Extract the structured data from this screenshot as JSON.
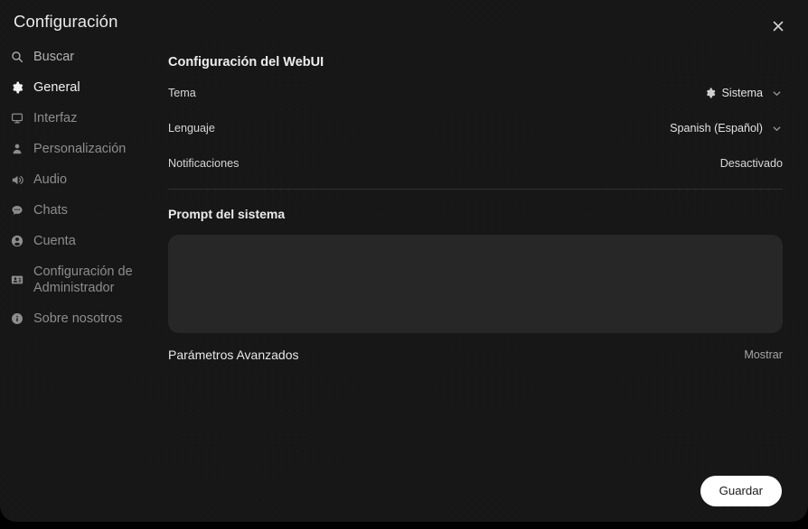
{
  "window": {
    "title": "Configuración",
    "close_icon": "close-icon"
  },
  "sidebar": {
    "items": [
      {
        "id": "buscar",
        "label": "Buscar",
        "icon": "search-icon",
        "active": false,
        "muted": false
      },
      {
        "id": "general",
        "label": "General",
        "icon": "gear-icon",
        "active": true,
        "muted": false
      },
      {
        "id": "interfaz",
        "label": "Interfaz",
        "icon": "monitor-icon",
        "active": false,
        "muted": true
      },
      {
        "id": "personalizacion",
        "label": "Personalización",
        "icon": "person-icon",
        "active": false,
        "muted": true
      },
      {
        "id": "audio",
        "label": "Audio",
        "icon": "speaker-icon",
        "active": false,
        "muted": true
      },
      {
        "id": "chats",
        "label": "Chats",
        "icon": "chat-icon",
        "active": false,
        "muted": true
      },
      {
        "id": "cuenta",
        "label": "Cuenta",
        "icon": "account-circle-icon",
        "active": false,
        "muted": true
      },
      {
        "id": "admin",
        "label": "Configuración de Administrador",
        "icon": "id-card-icon",
        "active": false,
        "muted": true
      },
      {
        "id": "sobre",
        "label": "Sobre nosotros",
        "icon": "info-icon",
        "active": false,
        "muted": true
      }
    ]
  },
  "main": {
    "section_title": "Configuración del WebUI",
    "settings": [
      {
        "label": "Tema",
        "value": "Sistema",
        "icon": "gear-icon",
        "control": "dropdown"
      },
      {
        "label": "Lenguaje",
        "value": "Spanish (Español)",
        "icon": null,
        "control": "dropdown"
      },
      {
        "label": "Notificaciones",
        "value": "Desactivado",
        "icon": null,
        "control": "toggle-text"
      }
    ],
    "prompt": {
      "title": "Prompt del sistema",
      "value": "",
      "placeholder": ""
    },
    "advanced": {
      "label": "Parámetros Avanzados",
      "toggle_label": "Mostrar"
    }
  },
  "footer": {
    "save_label": "Guardar"
  },
  "colors": {
    "modal_bg": "#171717",
    "textarea_bg": "#272727",
    "accent_button_bg": "#ffffff",
    "accent_button_text": "#1a1a1a",
    "text_primary": "#ececec",
    "text_muted": "#8d8d8d",
    "divider": "#2f2f2f"
  }
}
